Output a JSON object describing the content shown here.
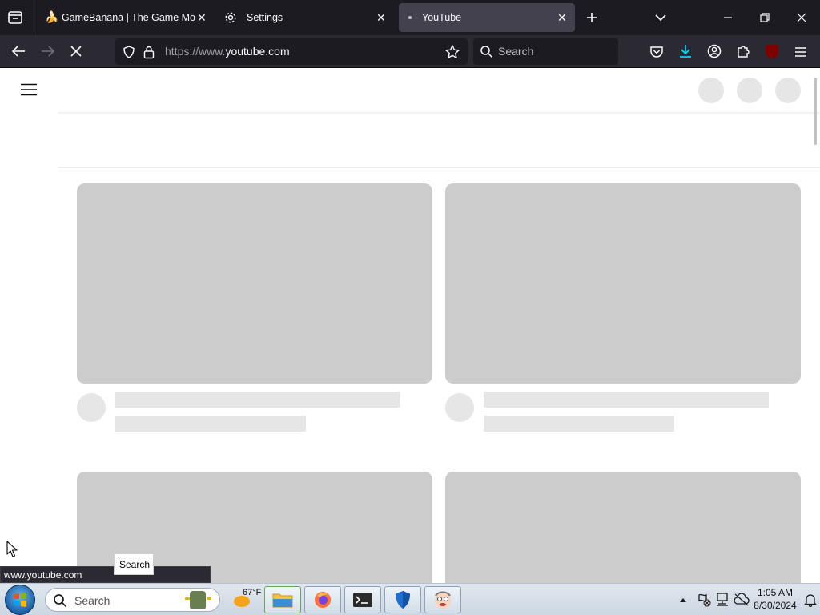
{
  "browser": {
    "tabs": [
      {
        "label": "GameBanana | The Game Mod",
        "icon": "banana-icon",
        "active": false
      },
      {
        "label": "Settings",
        "icon": "gear-icon",
        "active": false
      },
      {
        "label": "YouTube",
        "icon": "dot-icon",
        "active": true
      }
    ],
    "url": {
      "scheme": "https://www.",
      "host": "youtube.com"
    },
    "search_placeholder": "Search"
  },
  "status": {
    "link_preview": "www.youtube.com",
    "tooltip": "Search"
  },
  "taskbar": {
    "search_placeholder": "Search",
    "weather": "67°F",
    "time": "1:05 AM",
    "date": "8/30/2024"
  },
  "colors": {
    "tab_strip": "#1c1b22",
    "toolbar": "#2b2a33",
    "skeleton": "#cccccc",
    "skeleton_light": "#e6e6e6",
    "download_accent": "#00ddff",
    "ublock_red": "#800000"
  }
}
